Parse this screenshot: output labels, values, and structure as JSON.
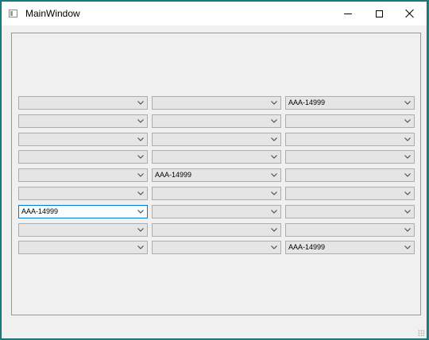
{
  "window": {
    "title": "MainWindow"
  },
  "combo_grid": {
    "rows": [
      [
        "",
        "",
        "AAA-14999"
      ],
      [
        "",
        "",
        ""
      ],
      [
        "",
        "",
        ""
      ],
      [
        "",
        "",
        ""
      ],
      [
        "",
        "AAA-14999",
        ""
      ],
      [
        "",
        "",
        ""
      ],
      [
        "AAA-14999",
        "",
        ""
      ],
      [
        "",
        "",
        ""
      ],
      [
        "",
        "",
        "AAA-14999"
      ]
    ],
    "focused": {
      "row": 6,
      "col": 0
    }
  },
  "colors": {
    "desktop": "#1e7f80",
    "window_bg": "#f0f0f0",
    "combo_bg": "#e5e5e5",
    "combo_border": "#adadad",
    "focus_border": "#0078d7"
  },
  "icons": [
    "app-window-icon",
    "minimize-icon",
    "maximize-icon",
    "close-icon",
    "chevron-down-icon",
    "size-grip-icon"
  ]
}
